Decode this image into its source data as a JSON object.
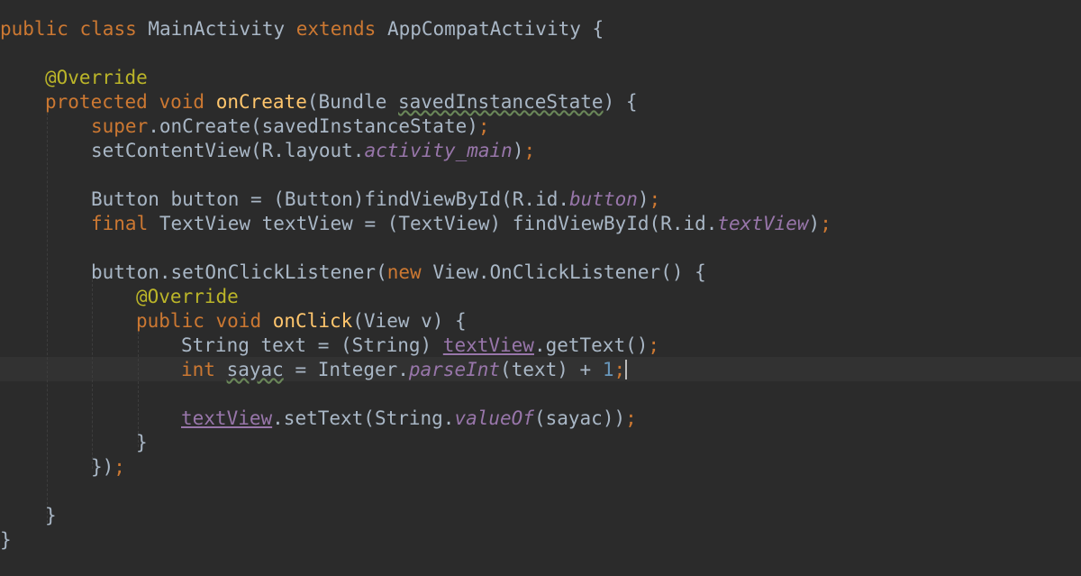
{
  "editor": {
    "theme_colors": {
      "background": "#2b2b2b",
      "keyword": "#cc7832",
      "annotation": "#bbb529",
      "method_decl": "#ffc66d",
      "field": "#9876aa",
      "number": "#6897bb",
      "text": "#a9b7c6"
    },
    "code": {
      "l1": {
        "t1": "public",
        "t2": "class",
        "t3": "MainActivity",
        "t4": "extends",
        "t5": "AppCompatActivity {"
      },
      "l2": {
        "t1": "@Override"
      },
      "l3": {
        "t1": "protected",
        "t2": "void",
        "t3": "onCreate",
        "t4": "(Bundle ",
        "t5": "savedInstanceState",
        "t6": ") {"
      },
      "l4": {
        "t1": "super",
        "t2": ".onCreate(savedInstanceState)",
        "t3": ";"
      },
      "l5": {
        "t1": "setContentView(R.layout.",
        "t2": "activity_main",
        "t3": ")",
        "t4": ";"
      },
      "l6": {
        "t1": "Button button = (Button)findViewById(R.id.",
        "t2": "button",
        "t3": ")",
        "t4": ";"
      },
      "l7": {
        "t1": "final",
        "t2": "TextView textView = (TextView) findViewById(R.id.",
        "t3": "textView",
        "t4": ")",
        "t5": ";"
      },
      "l8": {
        "t1": "button.setOnClickListener(",
        "t2": "new",
        "t3": "View.OnClickListener() {"
      },
      "l9": {
        "t1": "@Override"
      },
      "l10": {
        "t1": "public",
        "t2": "void",
        "t3": "onClick",
        "t4": "(View v) {"
      },
      "l11": {
        "t1": "String text = (String) ",
        "t2": "textView",
        "t3": ".getText()",
        "t4": ";"
      },
      "l12": {
        "t1": "int",
        "t2": "sayac",
        "t3": " = Integer.",
        "t4": "parseInt",
        "t5": "(text) + ",
        "t6": "1",
        "t7": ";"
      },
      "l13": {
        "t1": "textView",
        "t2": ".setText(String.",
        "t3": "valueOf",
        "t4": "(sayac))",
        "t5": ";"
      },
      "l14": {
        "t1": "}"
      },
      "l15": {
        "t1": "})",
        "t2": ";"
      },
      "l16": {
        "t1": "}"
      },
      "l17": {
        "t1": "}"
      }
    }
  }
}
